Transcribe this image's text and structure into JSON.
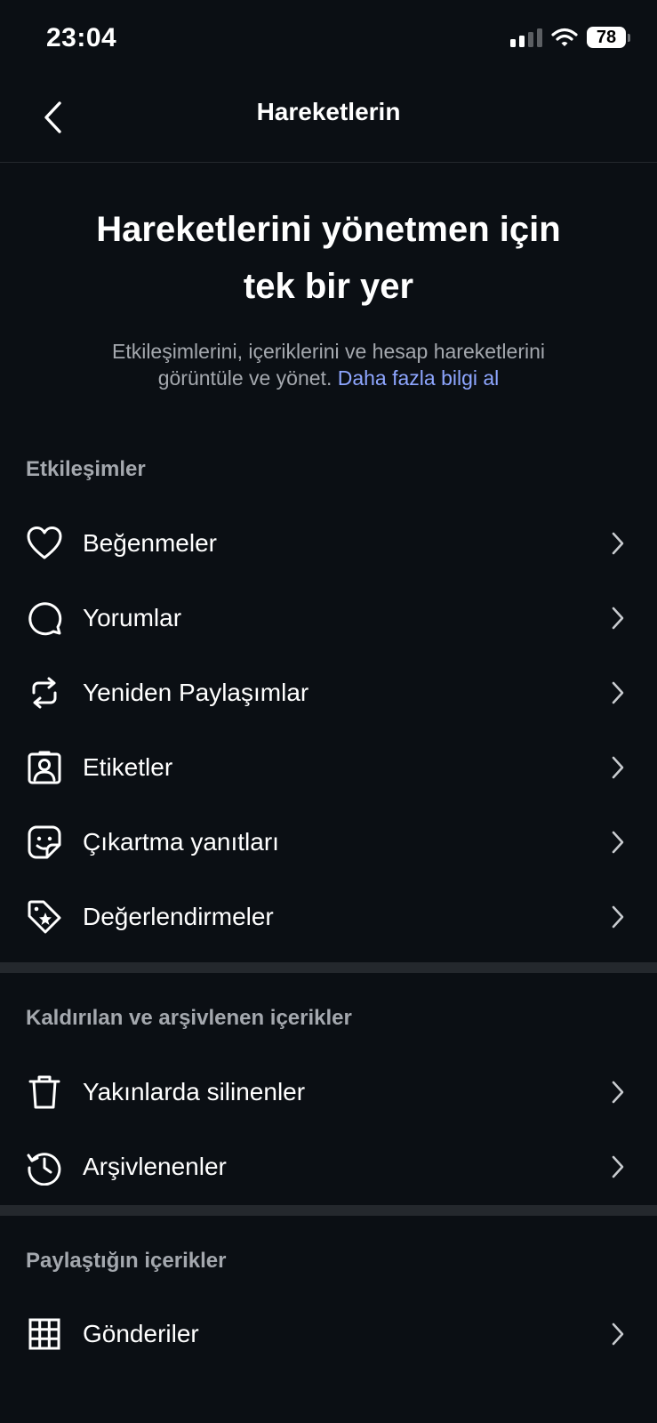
{
  "status_bar": {
    "time": "23:04",
    "battery": "78"
  },
  "nav": {
    "title": "Hareketlerin"
  },
  "hero": {
    "title": "Hareketlerini yönetmen için tek bir yer",
    "description": "Etkileşimlerini, içeriklerini ve hesap hareketlerini görüntüle ve yönet.",
    "link": "Daha fazla bilgi al"
  },
  "sections": {
    "interactions": {
      "header": "Etkileşimler",
      "items": [
        {
          "label": "Beğenmeler",
          "icon": "heart-icon"
        },
        {
          "label": "Yorumlar",
          "icon": "comment-icon"
        },
        {
          "label": "Yeniden Paylaşımlar",
          "icon": "repost-icon"
        },
        {
          "label": "Etiketler",
          "icon": "tag-person-icon"
        },
        {
          "label": "Çıkartma yanıtları",
          "icon": "sticker-icon"
        },
        {
          "label": "Değerlendirmeler",
          "icon": "review-tag-icon"
        }
      ]
    },
    "removed": {
      "header": "Kaldırılan ve arşivlenen içerikler",
      "items": [
        {
          "label": "Yakınlarda silinenler",
          "icon": "trash-icon"
        },
        {
          "label": "Arşivlenenler",
          "icon": "archive-history-icon"
        }
      ]
    },
    "shared": {
      "header": "Paylaştığın içerikler",
      "items": [
        {
          "label": "Gönderiler",
          "icon": "grid-icon"
        }
      ]
    }
  }
}
